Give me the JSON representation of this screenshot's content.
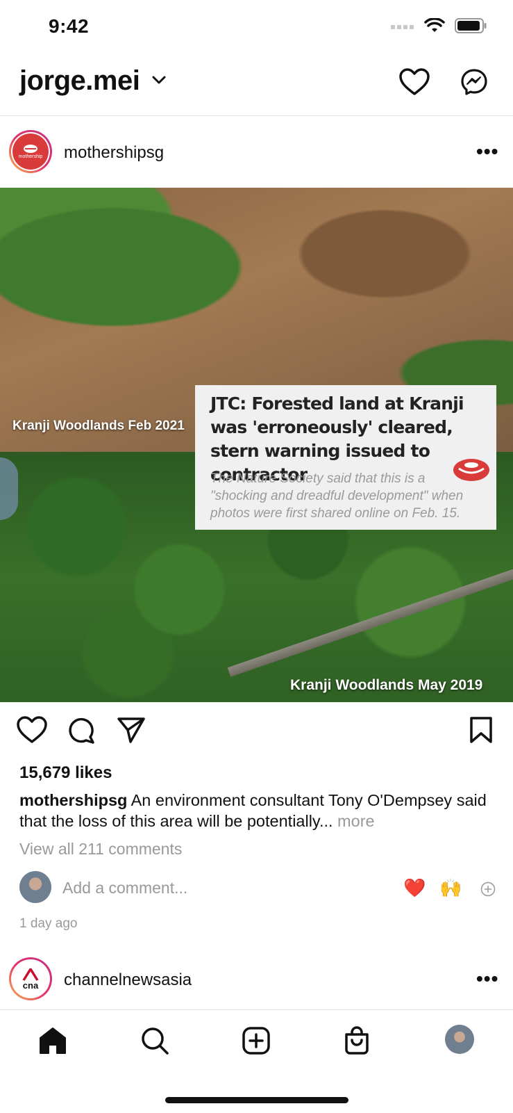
{
  "status_bar": {
    "time": "9:42"
  },
  "header": {
    "username": "jorge.mei"
  },
  "post": {
    "author": "mothershipsg",
    "avatar_text": "mothership",
    "image": {
      "label_top": "Kranji Woodlands   Feb 2021",
      "label_bottom": "Kranji Woodlands   May 2019",
      "card_title": "JTC: Forested land at Kranji was 'erroneously' cleared, stern warning issued to contractor",
      "card_subtitle": "The Nature Society said that this is a \"shocking and dreadful development\" when photos were first shared online on Feb. 15."
    },
    "likes": "15,679 likes",
    "caption_author": "mothershipsg",
    "caption_text": " An environment consultant Tony O'Dempsey said that the loss of this area will be potentially...",
    "caption_more": " more",
    "view_comments": "View all 211 comments",
    "comment_placeholder": "Add a comment...",
    "quick_emojis": [
      "❤️",
      "🙌"
    ],
    "time_ago": "1 day ago"
  },
  "next_post": {
    "author": "channelnewsasia",
    "avatar_text": "cna"
  },
  "colors": {
    "mothership_red": "#d93b3b",
    "cna_red": "#c8102e",
    "muted": "#999999"
  }
}
